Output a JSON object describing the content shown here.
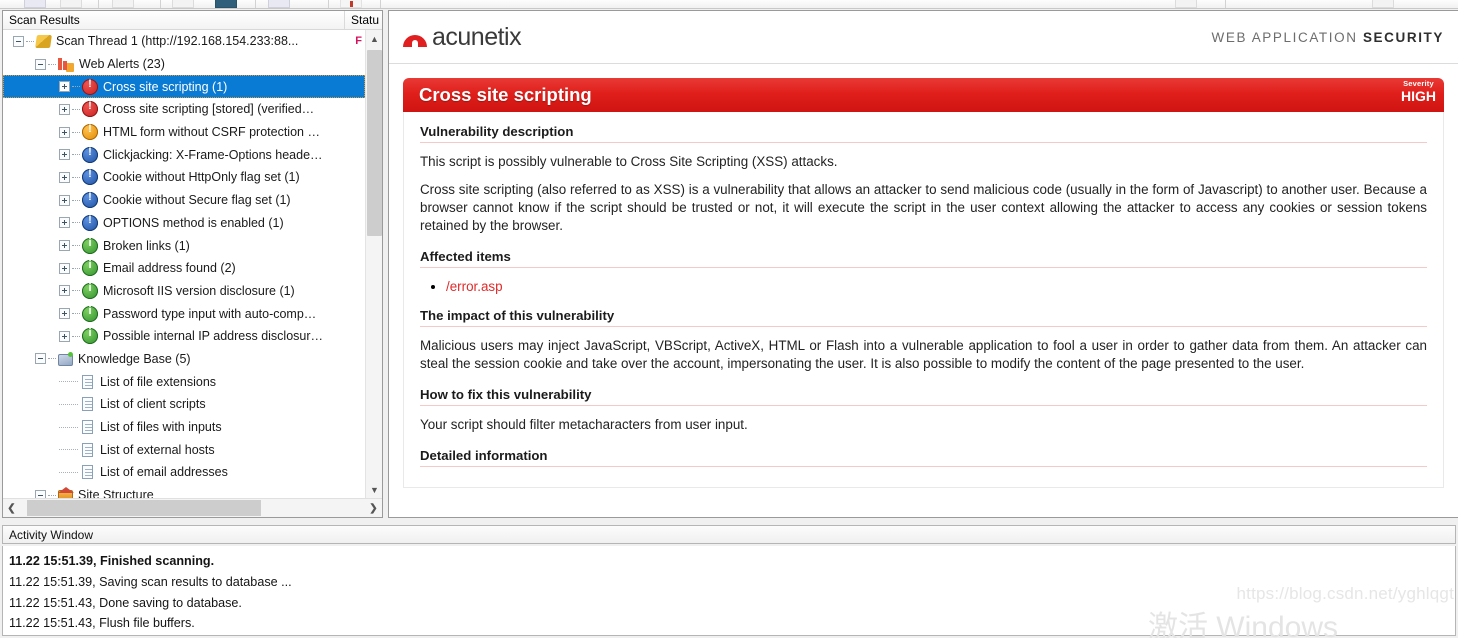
{
  "toolbar": {
    "name": "main-toolbar"
  },
  "tree": {
    "columns": {
      "name": "Scan Results",
      "status": "Statu"
    },
    "rows": [
      {
        "label": "Scan Thread 1 (http://192.168.154.233:88...",
        "icon": "scan-thread-icon",
        "indent": 0,
        "expander": "minus",
        "status": "F",
        "selected": false
      },
      {
        "label": "Web Alerts (23)",
        "icon": "web-alerts-icon",
        "indent": 1,
        "expander": "minus",
        "status": "",
        "selected": false
      },
      {
        "label": "Cross site scripting (1)",
        "icon": "severity-high-icon",
        "indent": 2,
        "expander": "plus",
        "status": "",
        "selected": true
      },
      {
        "label": "Cross site scripting [stored] (verified…",
        "icon": "severity-high-icon",
        "indent": 2,
        "expander": "plus",
        "status": "",
        "selected": false
      },
      {
        "label": "HTML form without CSRF protection …",
        "icon": "severity-medium-icon",
        "indent": 2,
        "expander": "plus",
        "status": "",
        "selected": false
      },
      {
        "label": "Clickjacking: X-Frame-Options heade…",
        "icon": "severity-low-icon",
        "indent": 2,
        "expander": "plus",
        "status": "",
        "selected": false
      },
      {
        "label": "Cookie without HttpOnly flag set (1)",
        "icon": "severity-low-icon",
        "indent": 2,
        "expander": "plus",
        "status": "",
        "selected": false
      },
      {
        "label": "Cookie without Secure flag set (1)",
        "icon": "severity-low-icon",
        "indent": 2,
        "expander": "plus",
        "status": "",
        "selected": false
      },
      {
        "label": "OPTIONS method is enabled (1)",
        "icon": "severity-low-icon",
        "indent": 2,
        "expander": "plus",
        "status": "",
        "selected": false
      },
      {
        "label": "Broken links (1)",
        "icon": "severity-info-icon",
        "indent": 2,
        "expander": "plus",
        "status": "",
        "selected": false
      },
      {
        "label": "Email address found (2)",
        "icon": "severity-info-icon",
        "indent": 2,
        "expander": "plus",
        "status": "",
        "selected": false
      },
      {
        "label": "Microsoft IIS version disclosure (1)",
        "icon": "severity-info-icon",
        "indent": 2,
        "expander": "plus",
        "status": "",
        "selected": false
      },
      {
        "label": "Password type input with auto-comp…",
        "icon": "severity-info-icon",
        "indent": 2,
        "expander": "plus",
        "status": "",
        "selected": false
      },
      {
        "label": "Possible internal IP address disclosur…",
        "icon": "severity-info-icon",
        "indent": 2,
        "expander": "plus",
        "status": "",
        "selected": false
      },
      {
        "label": "Knowledge Base (5)",
        "icon": "knowledge-base-icon",
        "indent": 1,
        "expander": "minus",
        "status": "",
        "selected": false
      },
      {
        "label": "List of file extensions",
        "icon": "document-icon",
        "indent": 2,
        "expander": "leaf",
        "status": "",
        "selected": false
      },
      {
        "label": "List of client scripts",
        "icon": "document-icon",
        "indent": 2,
        "expander": "leaf",
        "status": "",
        "selected": false
      },
      {
        "label": "List of files with inputs",
        "icon": "document-icon",
        "indent": 2,
        "expander": "leaf",
        "status": "",
        "selected": false
      },
      {
        "label": "List of external hosts",
        "icon": "document-icon",
        "indent": 2,
        "expander": "leaf",
        "status": "",
        "selected": false
      },
      {
        "label": "List of email addresses",
        "icon": "document-icon",
        "indent": 2,
        "expander": "leaf",
        "status": "",
        "selected": false
      },
      {
        "label": "Site Structure",
        "icon": "site-structure-icon",
        "indent": 1,
        "expander": "minus",
        "status": "",
        "selected": false
      }
    ]
  },
  "report": {
    "brand": "acunetix",
    "tagline_light": "WEB APPLICATION ",
    "tagline_bold": "SECURITY",
    "vulnerability_title": "Cross site scripting",
    "severity_label": "Severity",
    "severity_value": "HIGH",
    "sections": {
      "description_heading": "Vulnerability description",
      "description_p1": "This script is possibly vulnerable to Cross Site Scripting (XSS) attacks.",
      "description_p2": "Cross site scripting (also referred to as XSS) is a vulnerability that allows an attacker to send malicious code (usually in the form of Javascript) to another user. Because a browser cannot know if the script should be trusted or not, it will execute the script in the user context allowing the attacker to access any cookies or session tokens retained by the browser.",
      "affected_heading": "Affected items",
      "affected_items": [
        "/error.asp"
      ],
      "impact_heading": "The impact of this vulnerability",
      "impact_p1": "Malicious users may inject JavaScript, VBScript, ActiveX, HTML or Flash into a vulnerable application to fool a user in order to gather data from them. An attacker can steal the session cookie and take over the account, impersonating the user. It is also possible to modify the content of the page presented to the user.",
      "fix_heading": "How to fix this vulnerability",
      "fix_p1": "Your script should filter metacharacters from user input.",
      "detailed_heading": "Detailed information"
    }
  },
  "activity": {
    "title": "Activity Window",
    "lines": [
      {
        "text": "11.22 15:51.39, Finished scanning.",
        "bold": true
      },
      {
        "text": "11.22 15:51.39, Saving scan results to database ...",
        "bold": false
      },
      {
        "text": "11.22 15:51.43, Done saving to database.",
        "bold": false
      },
      {
        "text": "11.22 15:51.43, Flush file buffers.",
        "bold": false
      }
    ]
  },
  "watermarks": {
    "url": "https://blog.csdn.net/yghlqgt",
    "windows": "激活 Windows"
  },
  "colors": {
    "accent_red": "#e02020",
    "selection_blue": "#0a7bd4",
    "severity_high": "#c62020",
    "severity_medium": "#e08800",
    "severity_low": "#1d4f9e",
    "severity_info": "#2f8f2f"
  }
}
